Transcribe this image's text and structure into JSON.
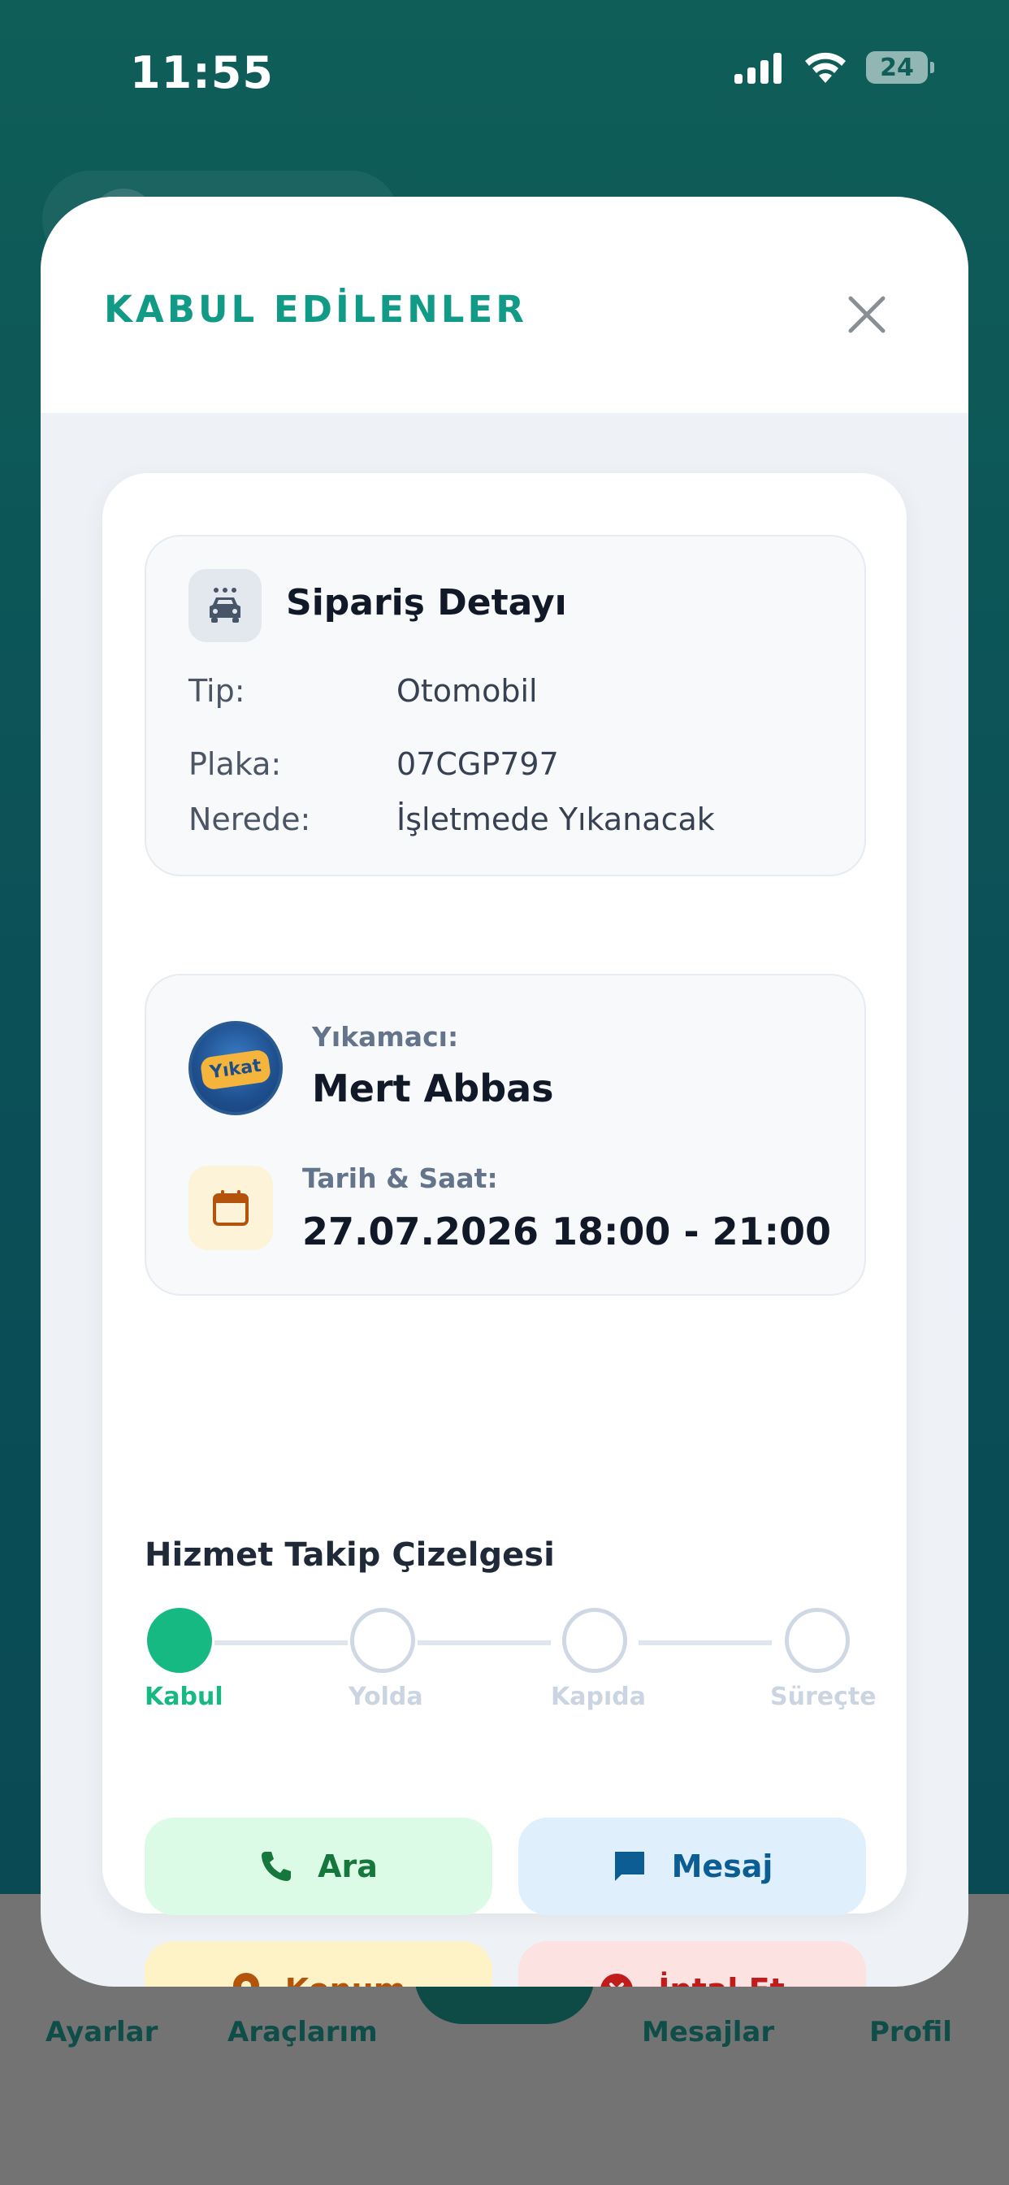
{
  "status_bar": {
    "time": "11:55",
    "battery": "24"
  },
  "bottom_nav": {
    "items": [
      {
        "label": "Ayarlar"
      },
      {
        "label": "Araçlarım"
      },
      {
        "label": "Mesajlar"
      },
      {
        "label": "Profil"
      }
    ]
  },
  "modal": {
    "title": "KABUL EDİLENLER",
    "order": {
      "title": "Sipariş Detayı",
      "icon": "car-wash-icon",
      "rows": [
        {
          "label": "Tip:",
          "value": "Otomobil"
        },
        {
          "label": "Plaka:",
          "value": "07CGP797"
        },
        {
          "label": "Nerede:",
          "value": "İşletmede Yıkanacak"
        }
      ]
    },
    "washer": {
      "label": "Yıkamacı:",
      "name": "Mert Abbas",
      "avatar_text": "Yıkat",
      "datetime_label": "Tarih & Saat:",
      "datetime": "27.07.2026 18:00 - 21:00"
    },
    "tracking": {
      "title": "Hizmet Takip Çizelgesi",
      "steps": [
        {
          "label": "Kabul",
          "active": true
        },
        {
          "label": "Yolda",
          "active": false
        },
        {
          "label": "Kapıda",
          "active": false
        },
        {
          "label": "Süreçte",
          "active": false
        }
      ]
    },
    "actions": {
      "call": "Ara",
      "message": "Mesaj",
      "location": "Konum",
      "cancel": "İptal Et"
    }
  },
  "colors": {
    "accent": "#119a86",
    "step_active": "#16b981",
    "call": "#16773c",
    "message": "#0b5d94",
    "location": "#b4530c",
    "cancel": "#c01c1c"
  }
}
